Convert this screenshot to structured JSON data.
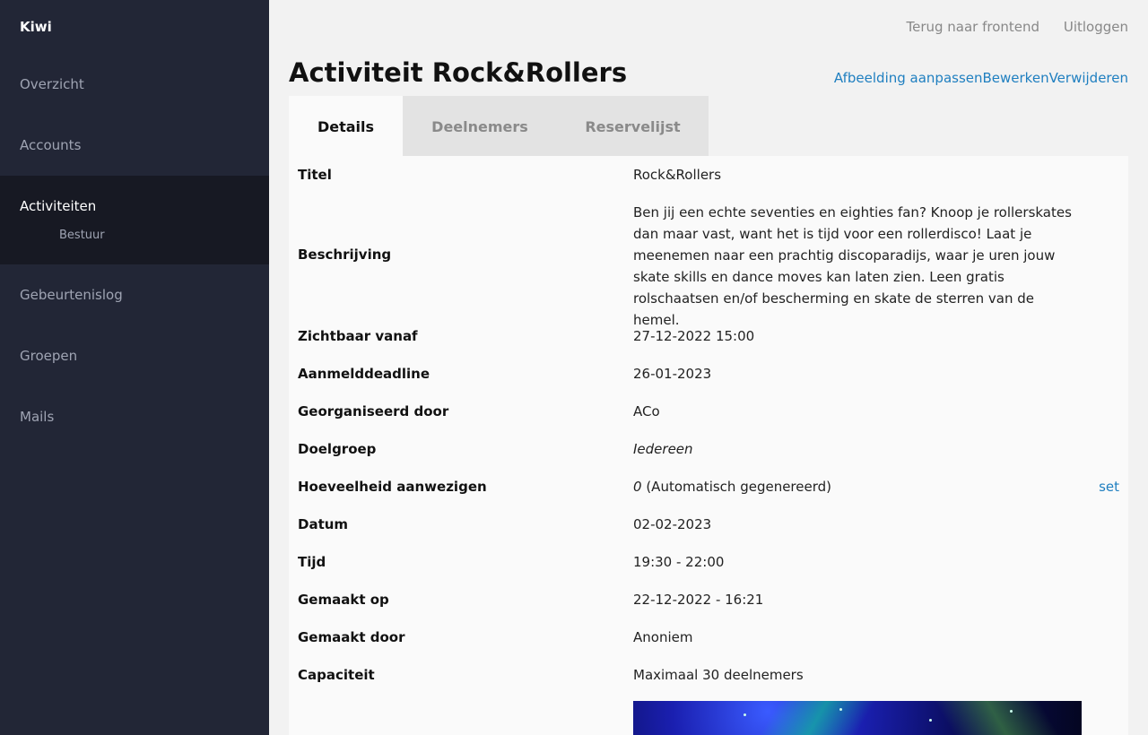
{
  "sidebar": {
    "brand": "Kiwi",
    "items": [
      {
        "label": "Overzicht"
      },
      {
        "label": "Accounts"
      },
      {
        "label": "Activiteiten",
        "sub": "Bestuur"
      },
      {
        "label": "Gebeurtenislog"
      },
      {
        "label": "Groepen"
      },
      {
        "label": "Mails"
      }
    ]
  },
  "topbar": {
    "frontend": "Terug naar frontend",
    "logout": "Uitloggen"
  },
  "header": {
    "title": "Activiteit Rock&Rollers",
    "actions": {
      "image": "Afbeelding aanpassen",
      "edit": "Bewerken",
      "delete": "Verwijderen"
    }
  },
  "tabs": [
    "Details",
    "Deelnemers",
    "Reservelijst"
  ],
  "details": {
    "title": {
      "label": "Titel",
      "value": "Rock&Rollers"
    },
    "description": {
      "label": "Beschrijving",
      "value": "Ben jij een echte seventies en eighties fan? Knoop je rollerskates dan maar vast, want het is tijd voor een rollerdisco! Laat je meenemen naar een prachtig discoparadijs, waar je uren jouw skate skills en dance moves kan laten zien. Leen gratis rolschaatsen en/of bescherming en skate de sterren van de hemel."
    },
    "visible_from": {
      "label": "Zichtbaar vanaf",
      "value": "27-12-2022 15:00"
    },
    "deadline": {
      "label": "Aanmelddeadline",
      "value": "26-01-2023"
    },
    "organizer": {
      "label": "Georganiseerd door",
      "value": "ACo"
    },
    "audience": {
      "label": "Doelgroep",
      "value": "Iedereen"
    },
    "attendance": {
      "label": "Hoeveelheid aanwezigen",
      "count": "0",
      "note": "(Automatisch gegenereerd)",
      "action": "set"
    },
    "date": {
      "label": "Datum",
      "value": "02-02-2023"
    },
    "time": {
      "label": "Tijd",
      "value": "19:30 - 22:00"
    },
    "created_at": {
      "label": "Gemaakt op",
      "value": "22-12-2022 - 16:21"
    },
    "created_by": {
      "label": "Gemaakt door",
      "value": "Anoniem"
    },
    "capacity": {
      "label": "Capaciteit",
      "value": "Maximaal 30 deelnemers"
    }
  }
}
